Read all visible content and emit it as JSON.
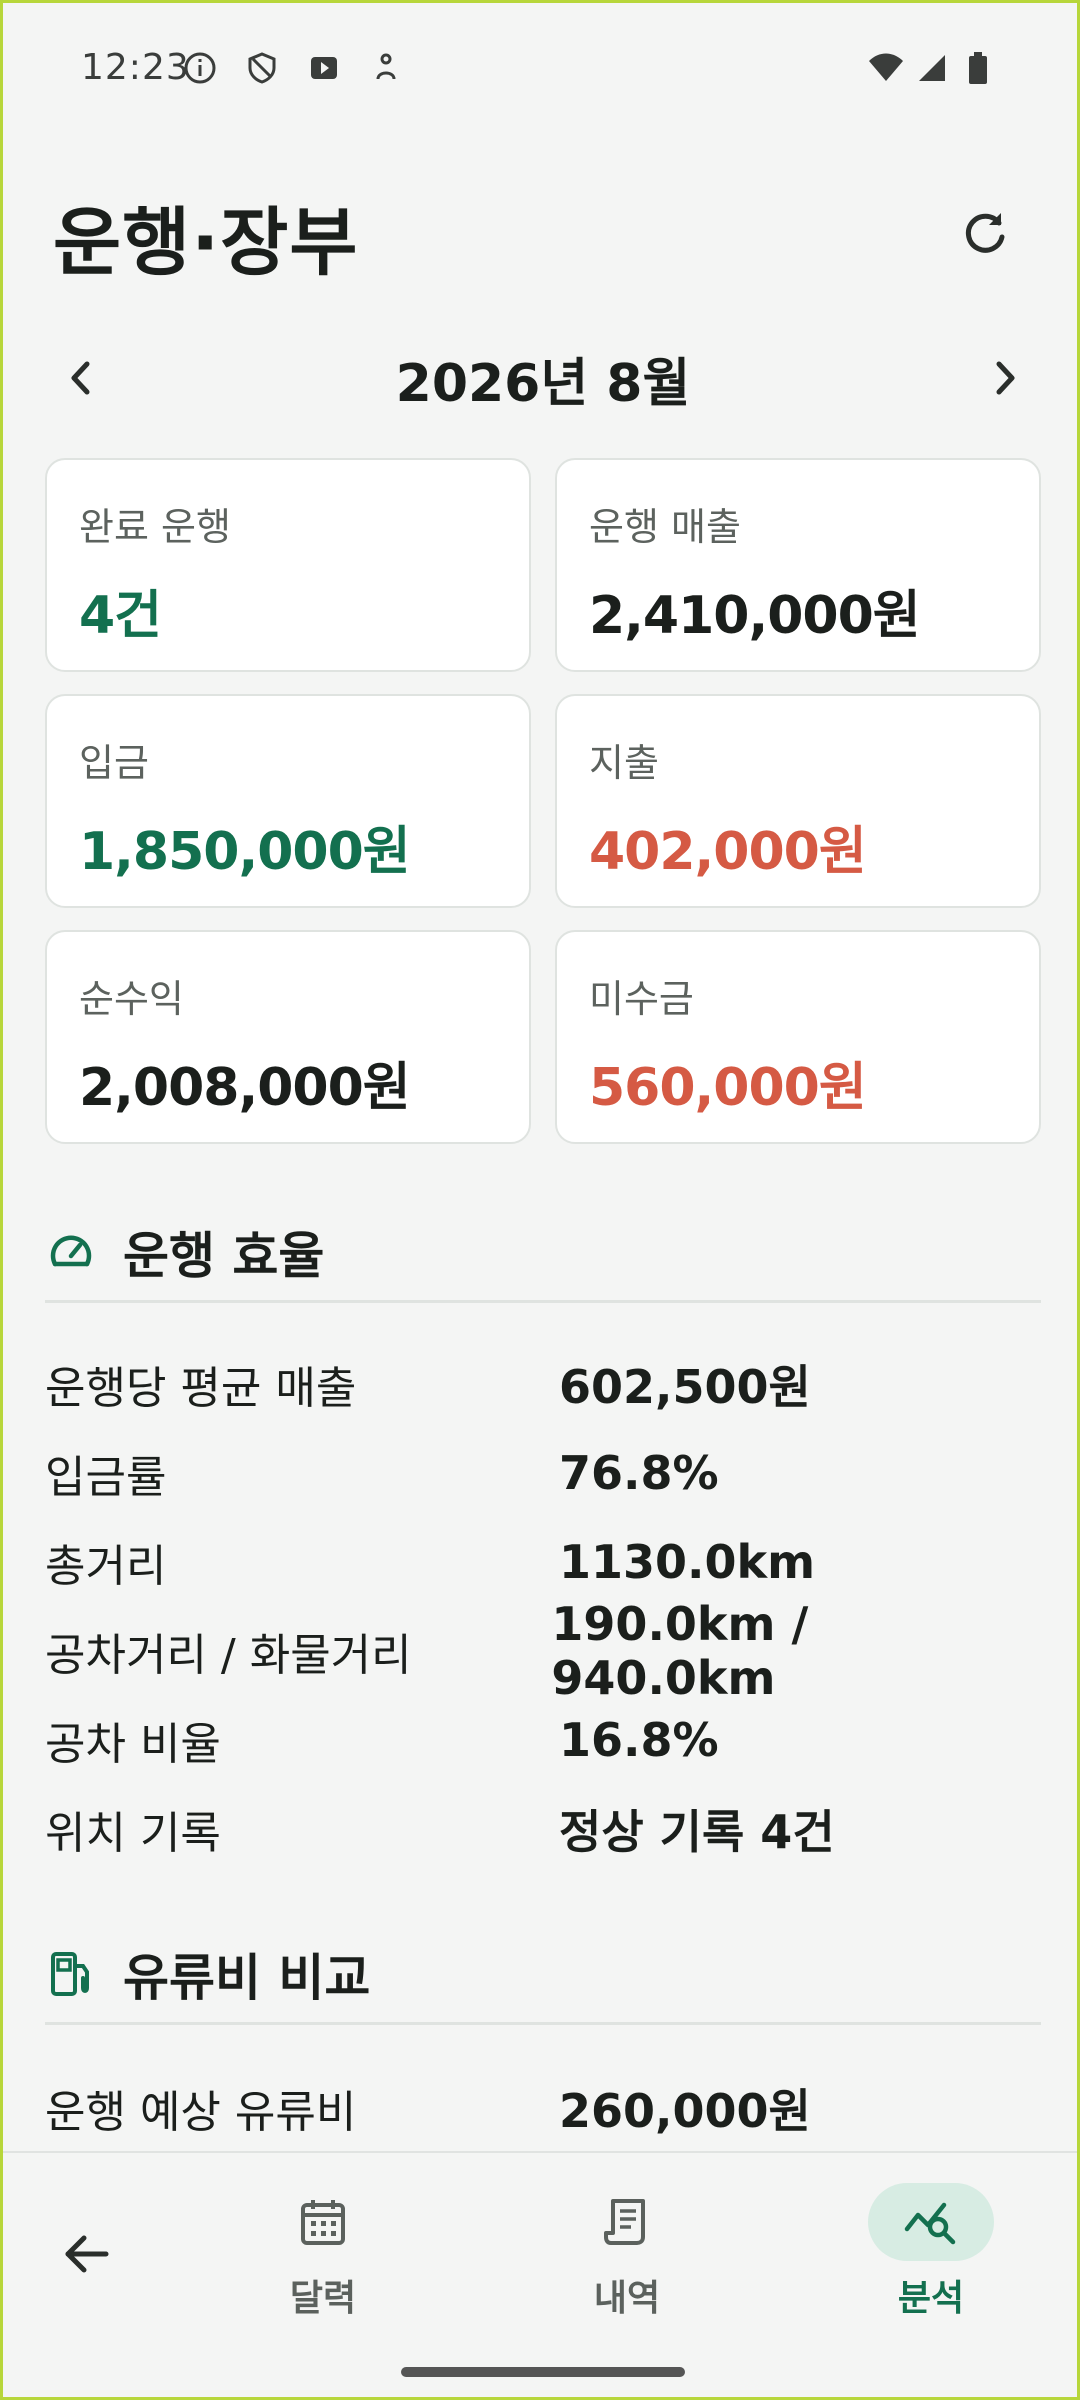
{
  "status_bar": {
    "time": "12:23",
    "left_icons": [
      "info-icon",
      "shield-icon",
      "media-icon",
      "accessibility-icon"
    ],
    "right_icons": [
      "wifi-icon",
      "signal-icon",
      "battery-icon"
    ]
  },
  "header": {
    "title": "운행·장부",
    "refresh_icon": "refresh-icon"
  },
  "month_nav": {
    "label": "2026년 8월",
    "prev_icon": "chevron-left-icon",
    "next_icon": "chevron-right-icon"
  },
  "cards": [
    {
      "label": "완료 운행",
      "value": "4건",
      "color": "#13704f"
    },
    {
      "label": "운행 매출",
      "value": "2,410,000원",
      "color": "#1b1f1c"
    },
    {
      "label": "입금",
      "value": "1,850,000원",
      "color": "#13704f"
    },
    {
      "label": "지출",
      "value": "402,000원",
      "color": "#d55a44"
    },
    {
      "label": "순수익",
      "value": "2,008,000원",
      "color": "#1b1f1c"
    },
    {
      "label": "미수금",
      "value": "560,000원",
      "color": "#d55a44"
    }
  ],
  "efficiency": {
    "title": "운행 효율",
    "icon": "speedometer-icon",
    "rows": [
      {
        "key": "운행당 평균 매출",
        "value": "602,500원"
      },
      {
        "key": "입금률",
        "value": "76.8%"
      },
      {
        "key": "총거리",
        "value": "1130.0km"
      },
      {
        "key": "공차거리 / 화물거리",
        "value": "190.0km / 940.0km"
      },
      {
        "key": "공차 비율",
        "value": "16.8%"
      },
      {
        "key": "위치 기록",
        "value": "정상 기록 4건"
      }
    ]
  },
  "fuel": {
    "title": "유류비 비교",
    "icon": "fuel-pump-icon",
    "rows": [
      {
        "key": "운행 예상 유류비",
        "value": "260,000원"
      }
    ]
  },
  "bottom_nav": {
    "back_icon": "arrow-back-icon",
    "items": [
      {
        "label": "달력",
        "icon": "calendar-icon",
        "active": false
      },
      {
        "label": "내역",
        "icon": "receipt-icon",
        "active": false
      },
      {
        "label": "분석",
        "icon": "analytics-icon",
        "active": true
      }
    ],
    "accent": "#13704f"
  }
}
